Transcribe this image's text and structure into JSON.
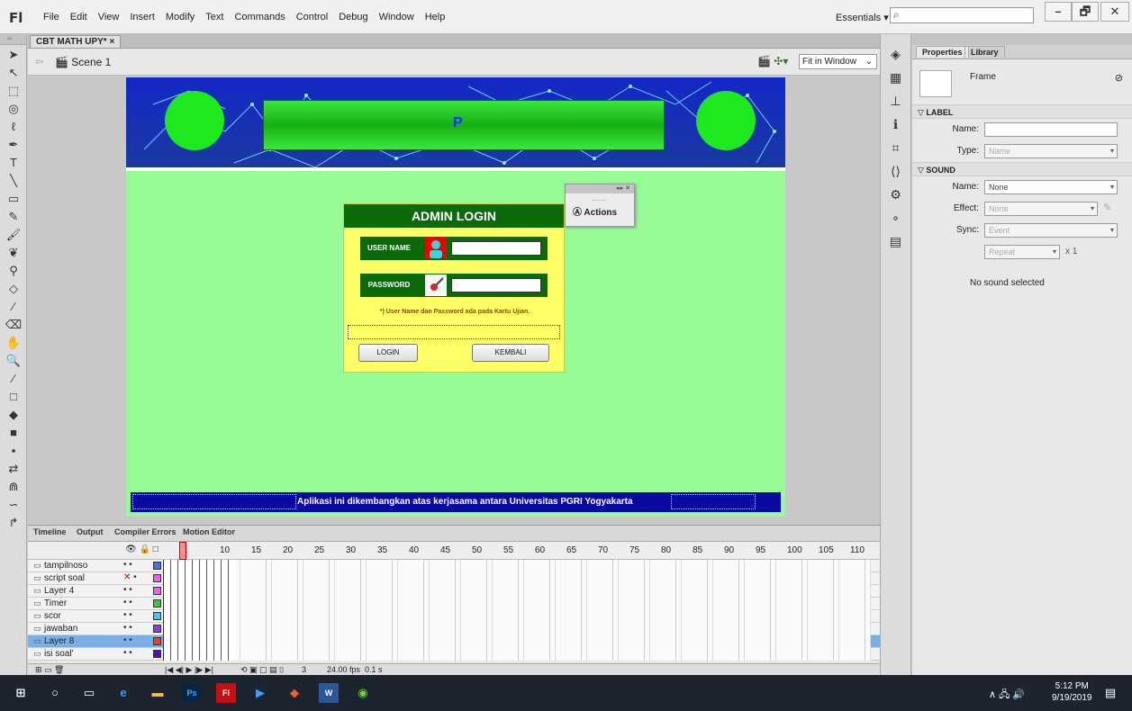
{
  "app": {
    "logo": "Fl",
    "menus": [
      "File",
      "Edit",
      "View",
      "Insert",
      "Modify",
      "Text",
      "Commands",
      "Control",
      "Debug",
      "Window",
      "Help"
    ],
    "workspace": "Essentials ▾",
    "window_controls": {
      "minimize": "–",
      "maximize": "🗗",
      "close": "✕"
    }
  },
  "document": {
    "tab": "CBT MATH UPY*  ×",
    "scene": "Scene 1",
    "zoom": "Fit in Window"
  },
  "stage": {
    "banner_letter": "P",
    "actions_panel": {
      "title": "Actions",
      "controls": "▸▸ ✕"
    },
    "login": {
      "title": "ADMIN LOGIN",
      "username_label": "USER NAME",
      "password_label": "PASSWORD",
      "note": "*)  User Name dan Password ada pada Kartu Ujian.",
      "login_button": "LOGIN",
      "back_button": "KEMBALI"
    },
    "footer": "Aplikasi ini dikembangkan atas kerjasama antara Universitas PGRI Yogyakarta"
  },
  "properties": {
    "tabs": [
      "Properties",
      "Library"
    ],
    "type": "Frame",
    "label_section": "LABEL",
    "name_label": "Name:",
    "type_label": "Type:",
    "type_value": "Name",
    "sound_section": "SOUND",
    "sound_name_label": "Name:",
    "sound_name_value": "None",
    "effect_label": "Effect:",
    "effect_value": "None",
    "sync_label": "Sync:",
    "sync_value": "Event",
    "repeat_value": "Repeat",
    "repeat_count": "x 1",
    "no_sound": "No sound selected"
  },
  "timeline": {
    "tabs": [
      "Timeline",
      "Output",
      "Compiler Errors",
      "Motion Editor"
    ],
    "frame_numbers": [
      "1",
      "5",
      "10",
      "15",
      "20",
      "25",
      "30",
      "35",
      "40",
      "45",
      "50",
      "55",
      "60",
      "65",
      "70",
      "75",
      "80",
      "85",
      "90",
      "95",
      "100",
      "105",
      "110"
    ],
    "layers": [
      {
        "name": "tampilnoso",
        "color": "#3b6fff"
      },
      {
        "name": "script soal",
        "color": "#ff55ff"
      },
      {
        "name": "Layer 4",
        "color": "#ff55ff"
      },
      {
        "name": "Timer",
        "color": "#33cc33"
      },
      {
        "name": "scor",
        "color": "#33ccff"
      },
      {
        "name": "jawaban",
        "color": "#9933ff"
      },
      {
        "name": "Layer 8",
        "color": "#ff3333"
      },
      {
        "name": "isi soal'",
        "color": "#6600cc"
      }
    ],
    "current_frame": "3",
    "fps": "24.00 fps",
    "time": "0.1 s"
  },
  "taskbar": {
    "time": "5:12 PM",
    "date": "9/19/2019",
    "notifications": "2"
  }
}
